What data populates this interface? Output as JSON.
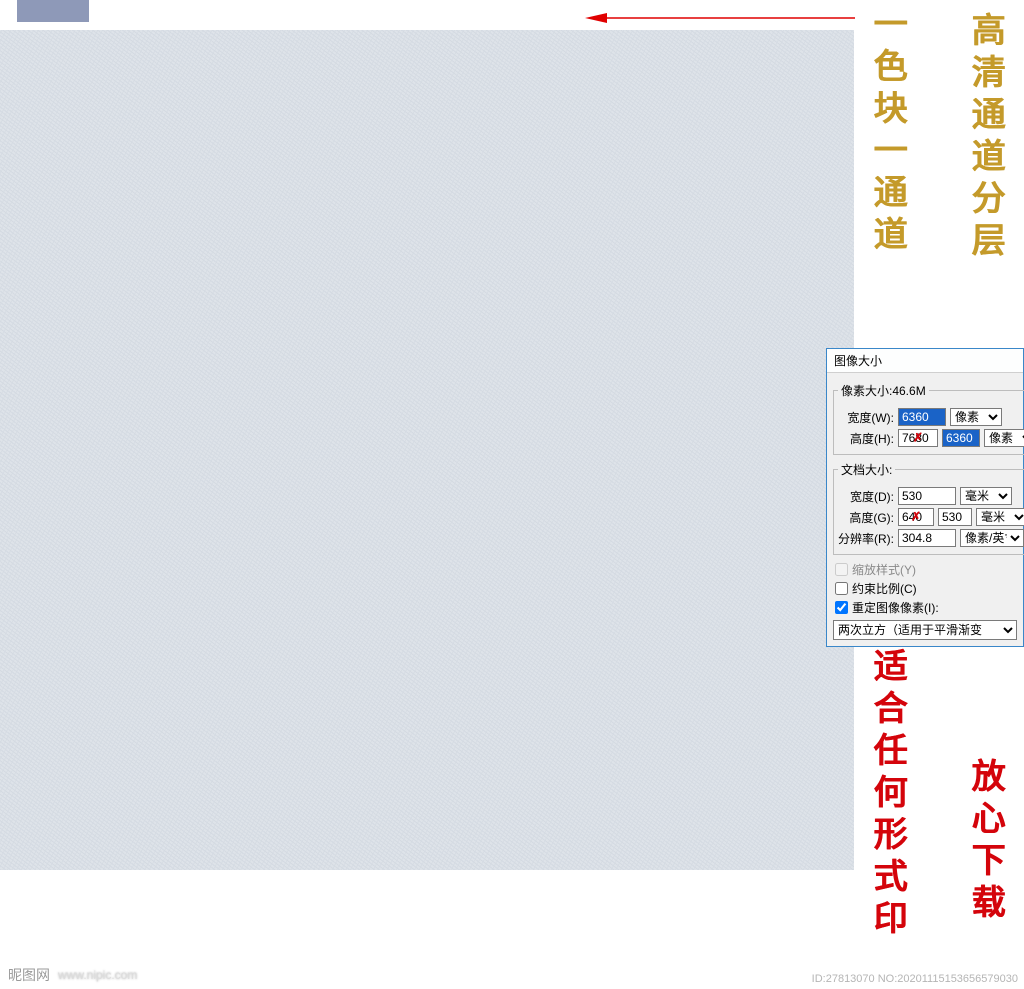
{
  "swatch_color": "#8e99b8",
  "annotations": {
    "col1_top": "一色块一通道",
    "col2_top": "高清通道分层",
    "col1_bottom": "适合任何形式印",
    "col2_bottom": "放心下载"
  },
  "dialog": {
    "title": "图像大小",
    "pixel_group": {
      "legend": "像素大小:46.6M",
      "width_label": "宽度(W):",
      "width_value": "6360",
      "width_unit": "像素",
      "height_label": "高度(H):",
      "height_old": "7680",
      "height_new": "6360",
      "height_unit": "像素"
    },
    "doc_group": {
      "legend": "文档大小:",
      "width_label": "宽度(D):",
      "width_value": "530",
      "width_unit": "毫米",
      "height_label": "高度(G):",
      "height_old": "640",
      "height_new": "530",
      "height_unit": "毫米",
      "res_label": "分辨率(R):",
      "res_value": "304.8",
      "res_unit": "像素/英寸"
    },
    "scale_styles": "缩放样式(Y)",
    "constrain": "约束比例(C)",
    "resample": "重定图像像素(I):",
    "resample_method": "两次立方（适用于平滑渐变"
  },
  "watermark": {
    "site_cn": "昵图网",
    "site_en": "www.nipic.com",
    "id": "ID:27813070 NO:20201115153656579030"
  }
}
